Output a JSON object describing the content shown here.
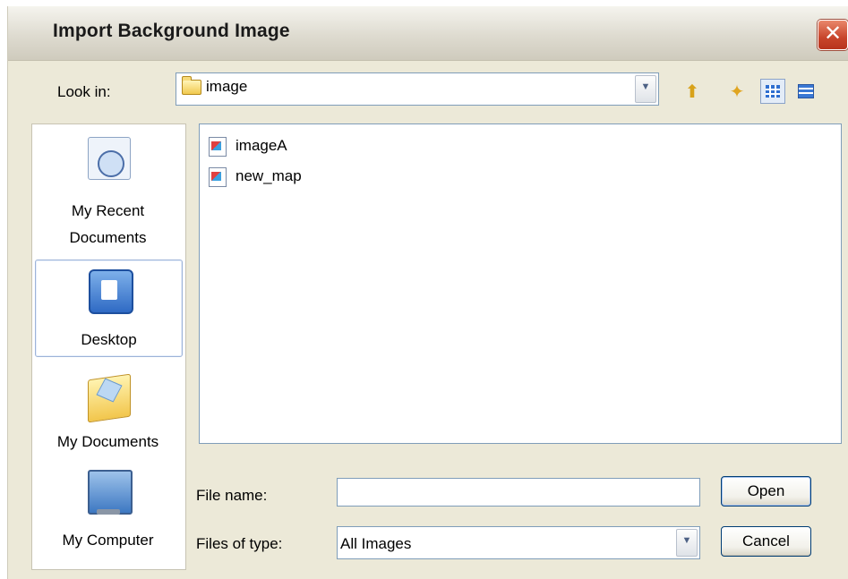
{
  "dialog": {
    "title": "Import Background Image",
    "close_glyph": "✕"
  },
  "toolbar": {
    "look_in_label": "Look in:",
    "look_in_value": "image",
    "look_in_icon": "folder-icon",
    "dropdown_glyph": "▼",
    "tools": [
      {
        "name": "up-one-level-icon",
        "glyph": "⬆"
      },
      {
        "name": "create-new-folder-icon",
        "glyph": "✦"
      },
      {
        "name": "list-view-icon",
        "glyph": ""
      },
      {
        "name": "details-view-icon",
        "glyph": ""
      }
    ]
  },
  "places": [
    {
      "label_line1": "My Recent",
      "label_line2": "Documents",
      "icon": "recent-documents-icon",
      "selected": false
    },
    {
      "label_line1": "Desktop",
      "label_line2": "",
      "icon": "desktop-icon",
      "selected": true
    },
    {
      "label_line1": "My Documents",
      "label_line2": "",
      "icon": "my-documents-icon",
      "selected": false
    },
    {
      "label_line1": "My Computer",
      "label_line2": "",
      "icon": "my-computer-icon",
      "selected": false
    }
  ],
  "files": [
    {
      "name": "imageA",
      "icon": "image-file-icon"
    },
    {
      "name": "new_map",
      "icon": "image-file-icon"
    }
  ],
  "file_name": {
    "label": "File name:",
    "value": ""
  },
  "file_type": {
    "label": "Files of type:",
    "value": "All Images"
  },
  "buttons": {
    "open": "Open",
    "cancel": "Cancel"
  }
}
